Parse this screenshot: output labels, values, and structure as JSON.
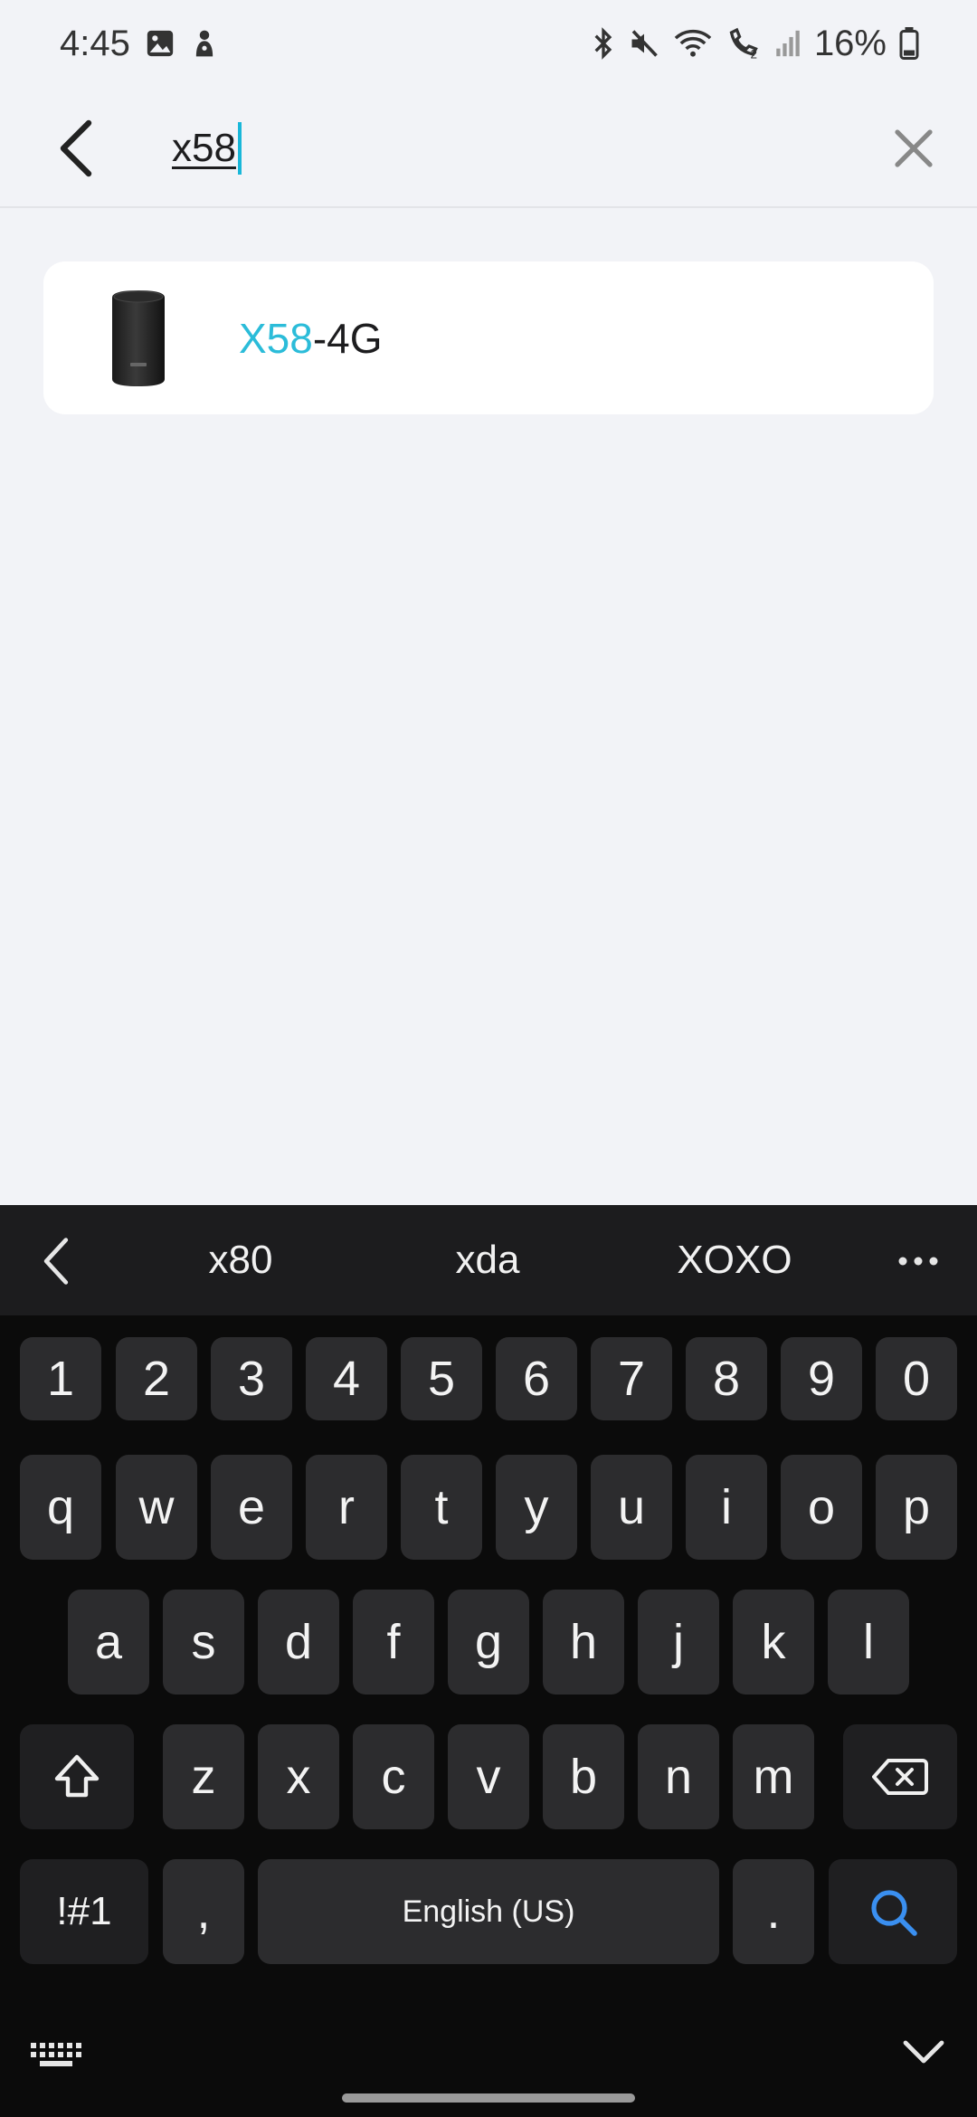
{
  "status_bar": {
    "time": "4:45",
    "battery": "16%",
    "icons_left": [
      "gallery-icon",
      "notification-app-icon"
    ],
    "icons_right": [
      "bluetooth-icon",
      "mute-icon",
      "wifi-icon",
      "wifi-calling-icon",
      "signal-icon",
      "battery-icon"
    ]
  },
  "search": {
    "query": "x58",
    "back_icon": "chevron-left-icon",
    "clear_icon": "close-icon",
    "accent_color": "#19b7d9"
  },
  "results": [
    {
      "match": "X58",
      "rest": "-4G",
      "image": "router-tower-icon"
    }
  ],
  "keyboard": {
    "suggestions": [
      "x80",
      "xda",
      "XOXO"
    ],
    "row_numbers": [
      "1",
      "2",
      "3",
      "4",
      "5",
      "6",
      "7",
      "8",
      "9",
      "0"
    ],
    "row_1": [
      "q",
      "w",
      "e",
      "r",
      "t",
      "y",
      "u",
      "i",
      "o",
      "p"
    ],
    "row_2": [
      "a",
      "s",
      "d",
      "f",
      "g",
      "h",
      "j",
      "k",
      "l"
    ],
    "row_3": [
      "z",
      "x",
      "c",
      "v",
      "b",
      "n",
      "m"
    ],
    "symbols_label": "!#1",
    "comma_label": ",",
    "space_label": "English (US)",
    "period_label": ".",
    "search_key_color": "#3a8ff0"
  }
}
